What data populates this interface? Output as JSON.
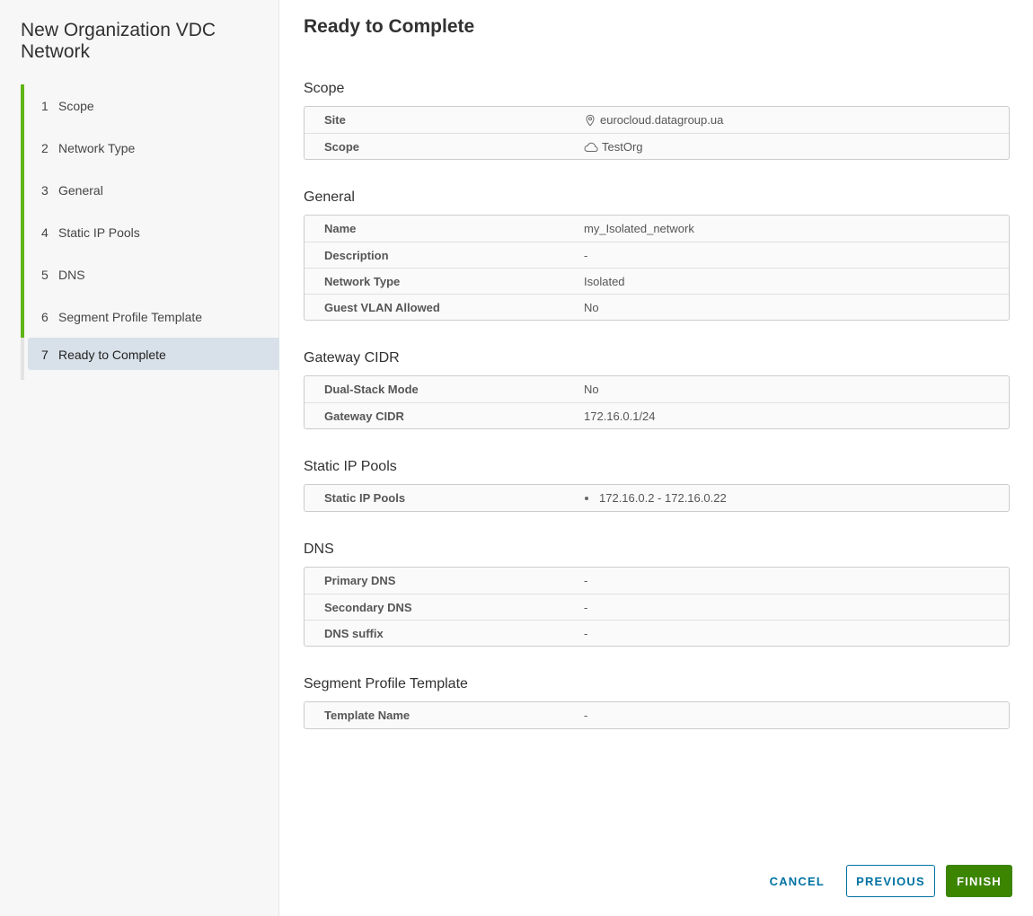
{
  "wizard": {
    "title": "New Organization VDC Network",
    "steps": [
      {
        "num": "1",
        "label": "Scope"
      },
      {
        "num": "2",
        "label": "Network Type"
      },
      {
        "num": "3",
        "label": "General"
      },
      {
        "num": "4",
        "label": "Static IP Pools"
      },
      {
        "num": "5",
        "label": "DNS"
      },
      {
        "num": "6",
        "label": "Segment Profile Template"
      },
      {
        "num": "7",
        "label": "Ready to Complete"
      }
    ],
    "current_step": 7
  },
  "main": {
    "title": "Ready to Complete",
    "sections": {
      "scope": {
        "title": "Scope",
        "rows": [
          {
            "key": "Site",
            "value": "eurocloud.datagroup.ua",
            "icon": "map-pin-icon"
          },
          {
            "key": "Scope",
            "value": "TestOrg",
            "icon": "cloud-icon"
          }
        ]
      },
      "general": {
        "title": "General",
        "rows": [
          {
            "key": "Name",
            "value": "my_Isolated_network"
          },
          {
            "key": "Description",
            "value": "-"
          },
          {
            "key": "Network Type",
            "value": "Isolated"
          },
          {
            "key": "Guest VLAN Allowed",
            "value": "No"
          }
        ]
      },
      "gateway": {
        "title": "Gateway CIDR",
        "rows": [
          {
            "key": "Dual-Stack Mode",
            "value": "No"
          },
          {
            "key": "Gateway CIDR",
            "value": "172.16.0.1/24"
          }
        ]
      },
      "pools": {
        "title": "Static IP Pools",
        "rows": [
          {
            "key": "Static IP Pools",
            "value": "172.16.0.2 - 172.16.0.22"
          }
        ]
      },
      "dns": {
        "title": "DNS",
        "rows": [
          {
            "key": "Primary DNS",
            "value": "-"
          },
          {
            "key": "Secondary DNS",
            "value": "-"
          },
          {
            "key": "DNS suffix",
            "value": "-"
          }
        ]
      },
      "segment": {
        "title": "Segment Profile Template",
        "rows": [
          {
            "key": "Template Name",
            "value": "-"
          }
        ]
      }
    }
  },
  "footer": {
    "cancel_label": "CANCEL",
    "previous_label": "PREVIOUS",
    "finish_label": "FINISH"
  },
  "colors": {
    "progress_green": "#60b515",
    "link_blue": "#0072a3",
    "finish_green": "#3c8500",
    "active_step_bg": "#d8e1e9"
  }
}
